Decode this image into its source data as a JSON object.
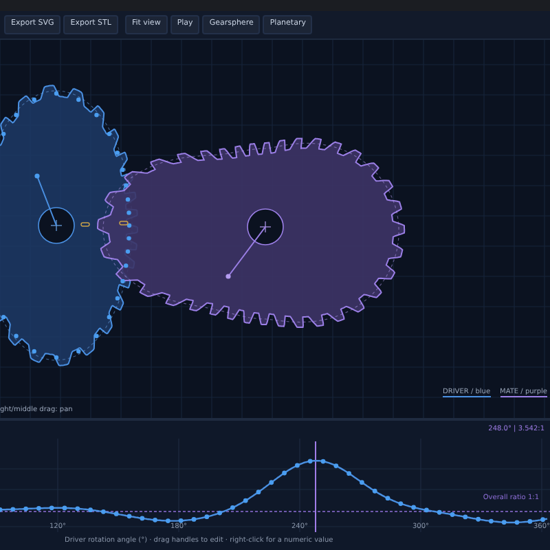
{
  "toolbar": {
    "groups": [
      [
        "Export SVG",
        "Export STL"
      ],
      [
        "Fit view",
        "Play",
        "Gearsphere",
        "Planetary"
      ]
    ]
  },
  "canvas": {
    "hint": "ght/middle drag: pan",
    "legend": [
      {
        "text": "DRIVER / blue",
        "color": "#4a90e2"
      },
      {
        "text": "MATE / purple",
        "color": "#9b7fe6"
      }
    ]
  },
  "ratio_chart": {
    "readout": "248.0°  |  3.542:1",
    "reference_label": "Overall ratio 1:1",
    "x_tick_labels": [
      "120°",
      "180°",
      "240°",
      "300°",
      "360°"
    ],
    "caption": "Driver rotation angle (°) · drag handles to edit · right-click for a numeric value"
  }
}
